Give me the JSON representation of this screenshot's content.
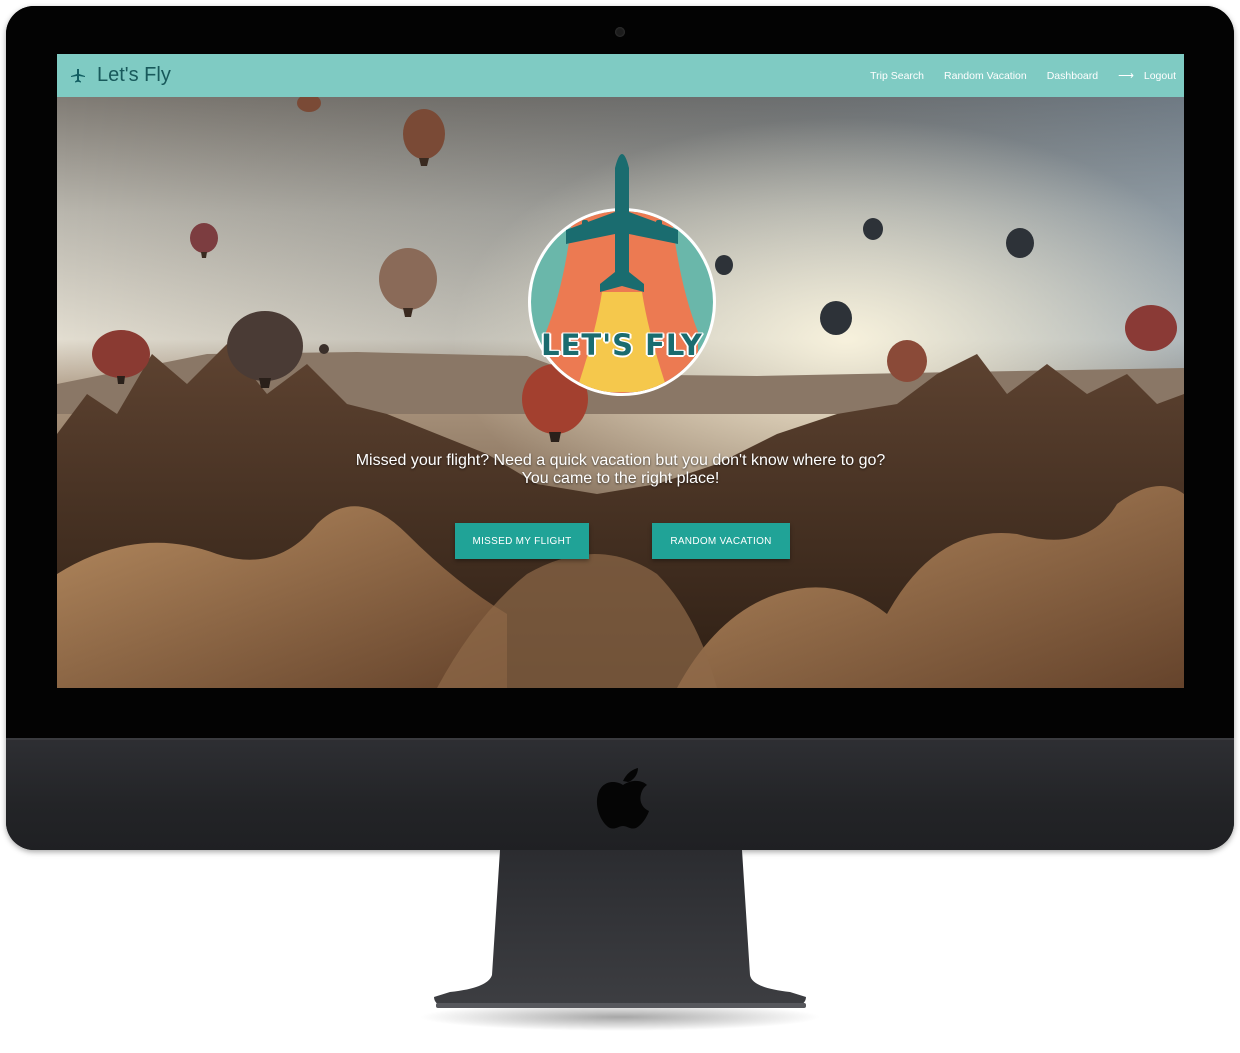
{
  "navbar": {
    "brand": "Let's Fly",
    "brand_icon": "airplane-icon",
    "links": [
      {
        "label": "Trip Search"
      },
      {
        "label": "Random Vacation"
      },
      {
        "label": "Dashboard"
      },
      {
        "label": "Logout",
        "icon": "arrow-right-icon"
      }
    ]
  },
  "hero": {
    "logo_text": "LET'S FLY",
    "tagline_line1": "Missed your flight? Need a quick vacation but you don't know where to go?",
    "tagline_line2": "You came to the right place!",
    "buttons": {
      "missed": "Missed my flight",
      "random": "Random vacation"
    }
  },
  "colors": {
    "navbar": "#7fcbc3",
    "brand_text": "#18595b",
    "button": "#20a397",
    "logo_teal": "#1a6c6f",
    "logo_orange": "#ec7a52",
    "logo_yellow": "#f5c84c",
    "logo_light_teal": "#6ab7aa"
  }
}
